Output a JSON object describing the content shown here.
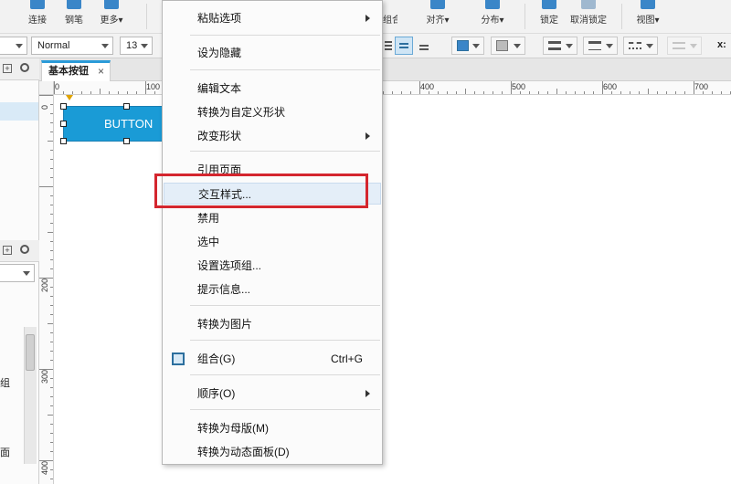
{
  "toolbar": {
    "buttons": [
      {
        "label": "连接",
        "color": "#3a86c8"
      },
      {
        "label": "钢笔",
        "color": "#3a86c8"
      },
      {
        "label": "更多▾",
        "color": "#3a86c8"
      },
      {
        "label": "组合",
        "color": "#3a86c8"
      },
      {
        "label": "对齐▾",
        "color": "#3a86c8"
      },
      {
        "label": "分布▾",
        "color": "#3a86c8"
      },
      {
        "label": "锁定",
        "color": "#3a86c8"
      },
      {
        "label": "取消锁定",
        "color": "#9fb8cf"
      },
      {
        "label": "视图▾",
        "color": "#3a86c8"
      }
    ],
    "font_style": "Normal",
    "font_size": "13",
    "x_label": "x:"
  },
  "tab": {
    "label": "基本按钮",
    "close": "×"
  },
  "rulers": {
    "top": [
      "0",
      "100",
      "400",
      "500",
      "600",
      "700"
    ],
    "left": [
      "0",
      "200",
      "300",
      "400"
    ]
  },
  "widget": {
    "label": "BUTTON",
    "fill": "#1a9bd6"
  },
  "left_panel": {
    "partial_text_1": "组",
    "partial_text_2": "面"
  },
  "context_menu": {
    "items": [
      {
        "label": "粘贴选项",
        "submenu": true
      },
      {
        "label": "设为隐藏"
      },
      {
        "label": "编辑文本"
      },
      {
        "label": "转换为自定义形状"
      },
      {
        "label": "改变形状",
        "submenu": true
      },
      {
        "label": "引用页面"
      },
      {
        "label": "交互样式..."
      },
      {
        "label": "禁用"
      },
      {
        "label": "选中"
      },
      {
        "label": "设置选项组..."
      },
      {
        "label": "提示信息..."
      },
      {
        "label": "转换为图片"
      },
      {
        "label": "组合(G)",
        "shortcut": "Ctrl+G",
        "icon": "group-icon"
      },
      {
        "label": "顺序(O)",
        "submenu": true
      },
      {
        "label": "转换为母版(M)"
      },
      {
        "label": "转换为动态面板(D)"
      }
    ]
  },
  "highlight_color": "#d4262e"
}
